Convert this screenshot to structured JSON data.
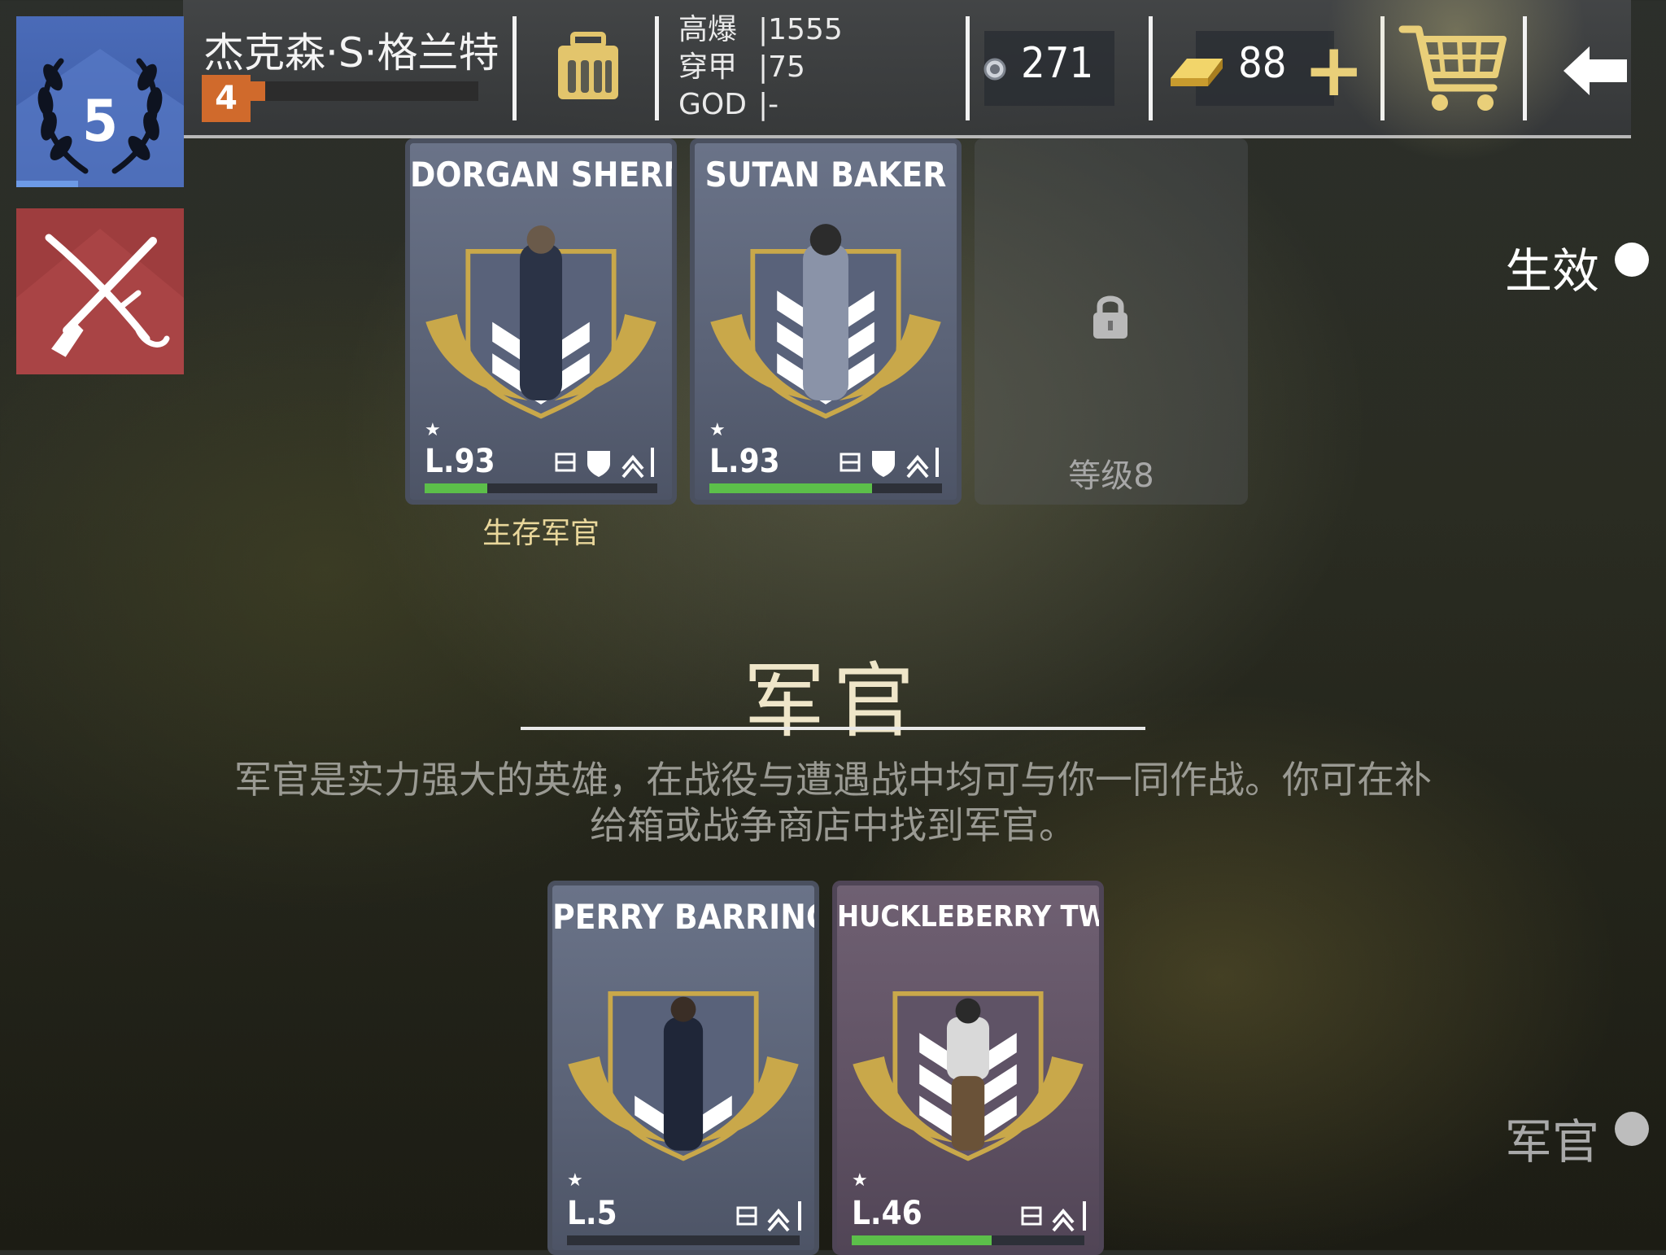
{
  "player": {
    "rank": "5",
    "name": "杰克森·S·格兰特",
    "sub_level": "4"
  },
  "stats": {
    "rows": [
      {
        "label": "高爆",
        "value": "|1555"
      },
      {
        "label": "穿甲",
        "value": "|75"
      },
      {
        "label": "GOD",
        "value": "|-"
      }
    ]
  },
  "currency": {
    "silver": "271",
    "gold": "88"
  },
  "icons": {
    "rank_emblem": "laurel-wreath-icon",
    "inventory": "ammo-box-icon",
    "silver": "silver-coin-icon",
    "gold": "gold-bar-icon",
    "add": "plus-icon",
    "shop": "shopping-cart-icon",
    "back": "back-arrow-icon",
    "mode": "crossed-musket-saber-icon",
    "lock": "lock-icon"
  },
  "colors": {
    "rank_blue": "#4a6bb8",
    "sublevel_orange": "#d06a2c",
    "mode_red": "#9e3d3e",
    "gold_accent": "#e9cf79",
    "progress_green": "#5cbf4a"
  },
  "active_section": {
    "toggle_label": "生效",
    "cards": [
      {
        "name": "DORGAN SHERMAN",
        "stars": "★",
        "level": "L.93",
        "progress": 0.27,
        "caption": "生存军官",
        "variant": "blue"
      },
      {
        "name": "SUTAN BAKER",
        "stars": "★",
        "level": "L.93",
        "progress": 0.7,
        "caption": "",
        "variant": "blue"
      }
    ],
    "locked_slot": {
      "label": "等级8"
    }
  },
  "officers_section": {
    "title": "军官",
    "description_line1": "军官是实力强大的英雄，在战役与遭遇战中均可与你一同作战。你可在补",
    "description_line2": "给箱或战争商店中找到军官。",
    "toggle_label": "军官",
    "cards": [
      {
        "name": "PERRY BARRINGER",
        "stars": "★",
        "level": "L.5",
        "progress": 0.0,
        "variant": "blue"
      },
      {
        "name": "HUCKLEBERRY TWIGGS",
        "stars": "★",
        "level": "L.46",
        "progress": 0.6,
        "variant": "brown"
      }
    ]
  }
}
